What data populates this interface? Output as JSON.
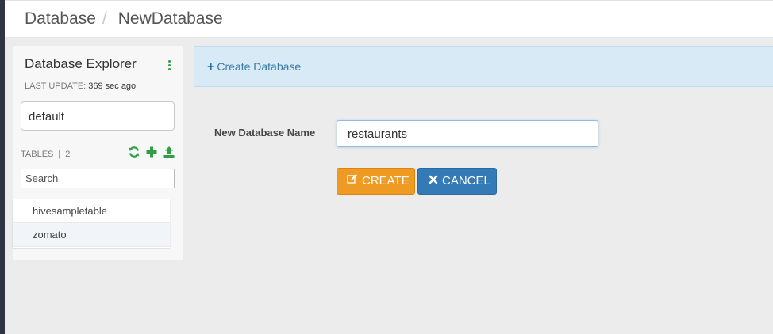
{
  "breadcrumb": {
    "root": "Database",
    "separator": "/",
    "current": "NewDatabase"
  },
  "sidebar": {
    "title": "Database Explorer",
    "menu_icon": "kebab-menu-icon",
    "last_update_label": "LAST UPDATE:",
    "last_update_value": "369 sec ago",
    "selected_database": "default",
    "tables_label": "TABLES",
    "tables_separator": "|",
    "tables_count": "2",
    "action_icons": [
      "refresh-icon",
      "add-icon",
      "upload-icon"
    ],
    "search_placeholder": "Search",
    "tables": [
      {
        "name": "hivesampletable"
      },
      {
        "name": "zomato"
      }
    ]
  },
  "banner": {
    "create_label": "Create Database",
    "icon": "plus-icon"
  },
  "form": {
    "name_label": "New Database Name",
    "name_value": "restaurants",
    "create_label": "CREATE",
    "cancel_label": "CANCEL"
  },
  "colors": {
    "accent_green": "#2f9e44",
    "banner_bg": "#d8eaf5",
    "create_button": "#ef9a22",
    "cancel_button": "#337ab7"
  }
}
